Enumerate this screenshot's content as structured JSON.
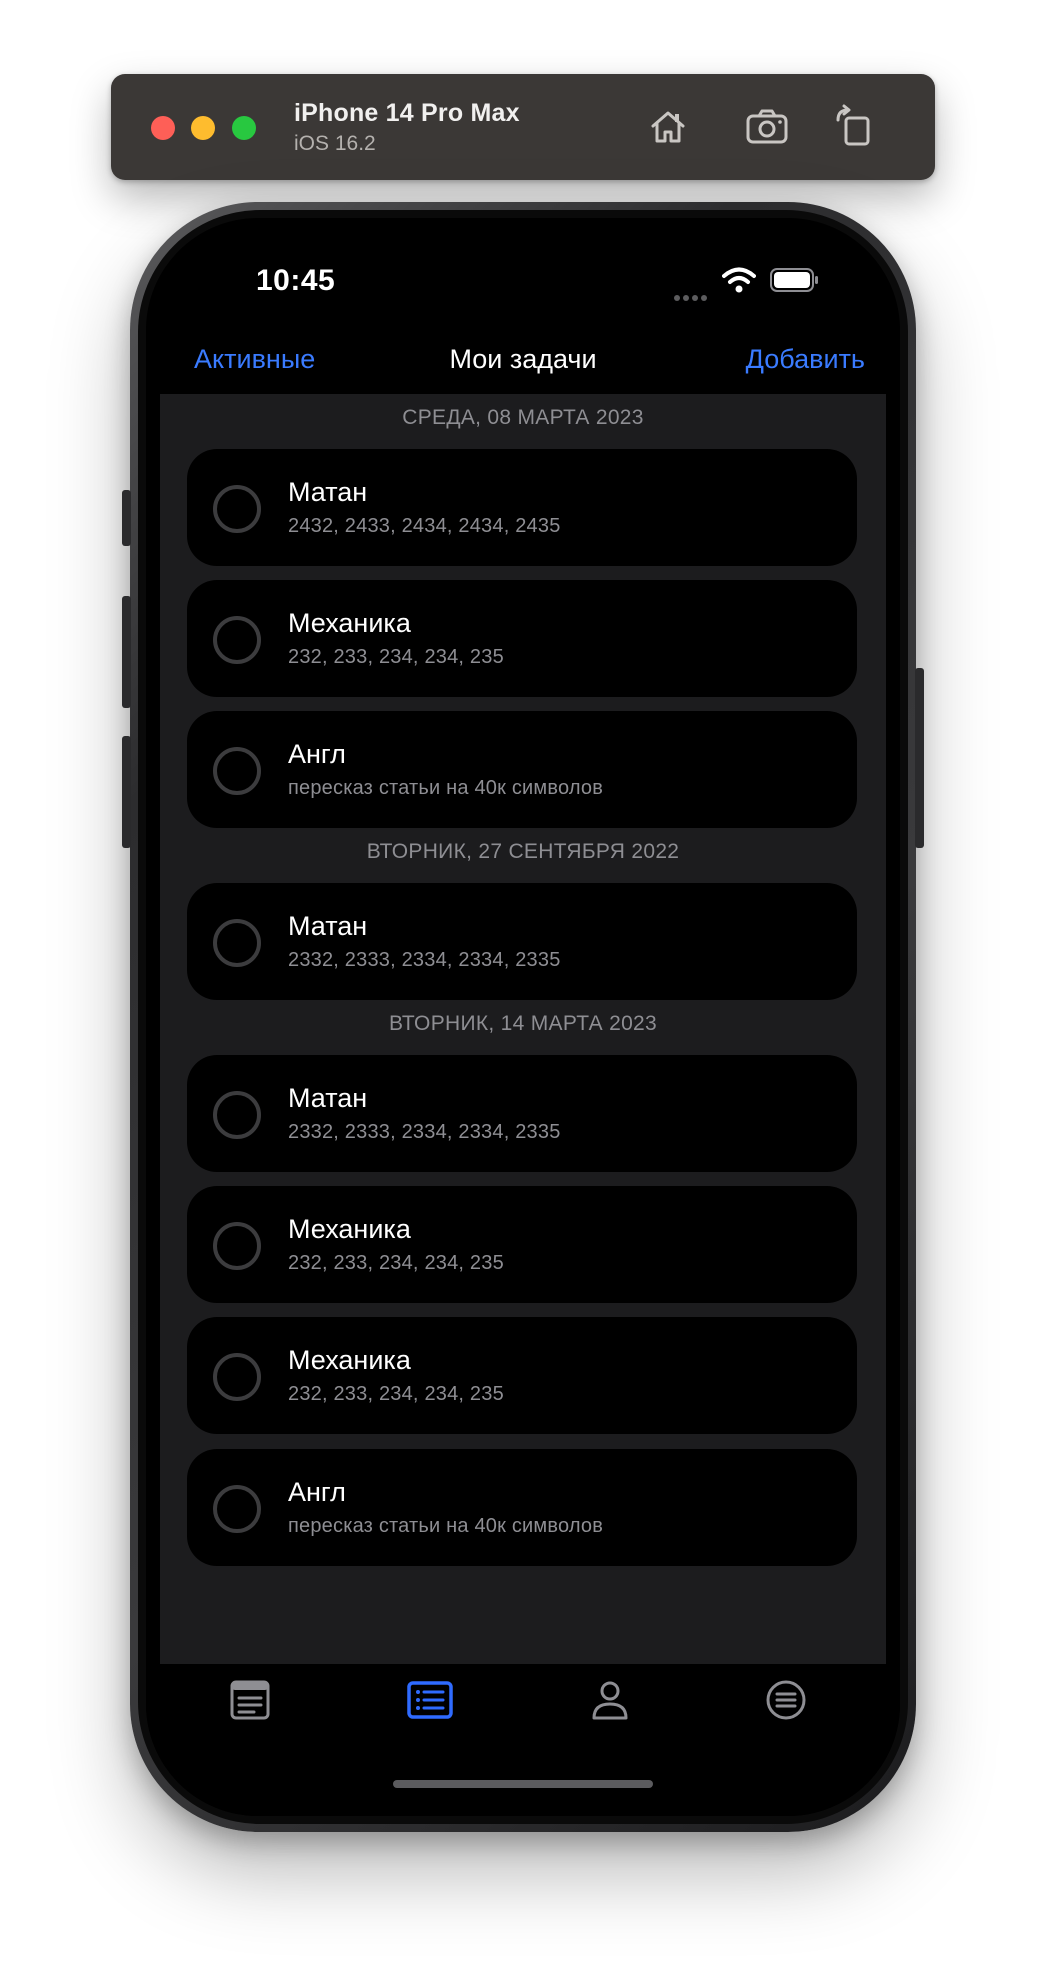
{
  "simulator": {
    "device_name": "iPhone 14 Pro Max",
    "os_version": "iOS 16.2",
    "buttons": [
      "home-icon",
      "screenshot-icon",
      "rotate-icon"
    ]
  },
  "status_bar": {
    "time": "10:45"
  },
  "nav": {
    "left_label": "Активные",
    "title": "Мои задачи",
    "right_label": "Добавить"
  },
  "sections": [
    {
      "header": "СРЕДА, 08 МАРТА 2023",
      "tasks": [
        {
          "title": "Матан",
          "subtitle": "2432, 2433, 2434, 2434, 2435"
        },
        {
          "title": "Механика",
          "subtitle": "232, 233, 234, 234, 235"
        },
        {
          "title": "Англ",
          "subtitle": "пересказ статьи на 40к символов"
        }
      ]
    },
    {
      "header": "ВТОРНИК, 27 СЕНТЯБРЯ 2022",
      "tasks": [
        {
          "title": "Матан",
          "subtitle": "2332, 2333, 2334, 2334, 2335"
        }
      ]
    },
    {
      "header": "ВТОРНИК, 14 МАРТА 2023",
      "tasks": [
        {
          "title": "Матан",
          "subtitle": "2332, 2333, 2334, 2334, 2335"
        },
        {
          "title": "Механика",
          "subtitle": "232, 233, 234, 234, 235"
        },
        {
          "title": "Механика",
          "subtitle": "232, 233, 234, 234, 235"
        },
        {
          "title": "Англ",
          "subtitle": "пересказ статьи на 40к символов"
        }
      ]
    }
  ],
  "tab_bar": {
    "tabs": [
      {
        "icon": "note-icon",
        "selected": false
      },
      {
        "icon": "list-icon",
        "selected": true
      },
      {
        "icon": "person-icon",
        "selected": false
      },
      {
        "icon": "menu-circle-icon",
        "selected": false
      }
    ]
  },
  "colors": {
    "accent": "#3a7bff",
    "background": "#000000",
    "list_background": "#1c1c1e",
    "secondary_text": "#8e8e93",
    "tab_inactive": "#8e8e93",
    "tab_active": "#2f6bff"
  }
}
